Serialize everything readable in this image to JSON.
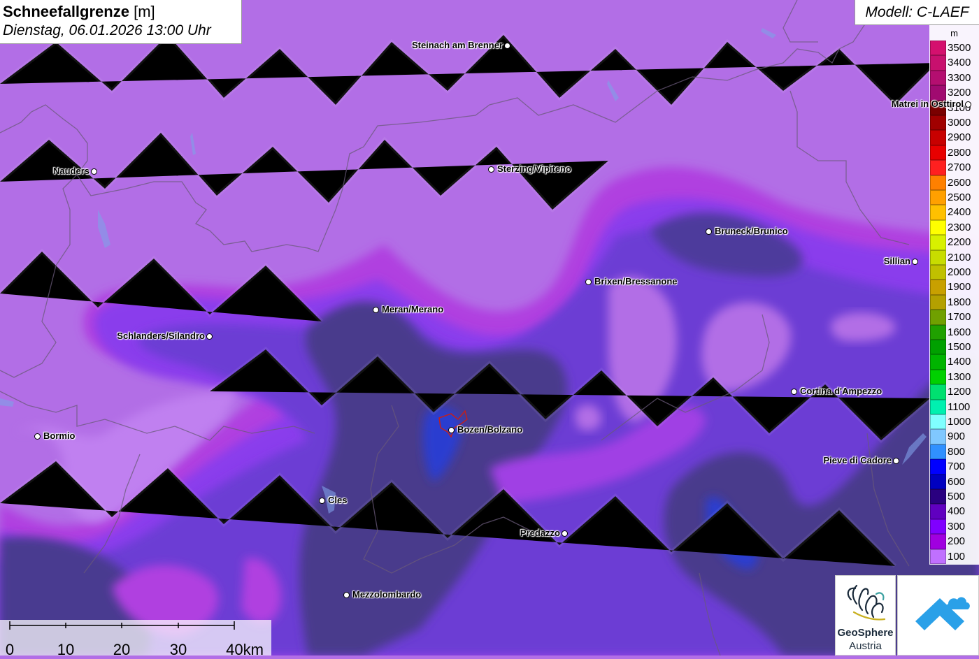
{
  "header": {
    "title": "Schneefallgrenze",
    "unit": "[m]",
    "datetime": "Dienstag, 06.01.2026 13:00 Uhr",
    "model": "Modell: C-LAEF"
  },
  "legend": {
    "unit": "m",
    "classes": [
      {
        "value": "3500",
        "color": "#d4106e"
      },
      {
        "value": "3400",
        "color": "#c8106e"
      },
      {
        "value": "3300",
        "color": "#b40e70"
      },
      {
        "value": "3200",
        "color": "#a00a70"
      },
      {
        "value": "3100",
        "color": "#7a0000"
      },
      {
        "value": "3000",
        "color": "#a00000"
      },
      {
        "value": "2900",
        "color": "#c80000"
      },
      {
        "value": "2800",
        "color": "#e80000"
      },
      {
        "value": "2700",
        "color": "#ff2020"
      },
      {
        "value": "2600",
        "color": "#ff8000"
      },
      {
        "value": "2500",
        "color": "#ffa000"
      },
      {
        "value": "2400",
        "color": "#ffc000"
      },
      {
        "value": "2300",
        "color": "#ffff00"
      },
      {
        "value": "2200",
        "color": "#d8f000"
      },
      {
        "value": "2100",
        "color": "#c8dc00"
      },
      {
        "value": "2000",
        "color": "#c0c000"
      },
      {
        "value": "1900",
        "color": "#c8a000"
      },
      {
        "value": "1800",
        "color": "#b4a000"
      },
      {
        "value": "1700",
        "color": "#70a000"
      },
      {
        "value": "1600",
        "color": "#20a000"
      },
      {
        "value": "1500",
        "color": "#00a000"
      },
      {
        "value": "1400",
        "color": "#00b400"
      },
      {
        "value": "1300",
        "color": "#00d000"
      },
      {
        "value": "1200",
        "color": "#00e070"
      },
      {
        "value": "1100",
        "color": "#00f0b0"
      },
      {
        "value": "1000",
        "color": "#80ffff"
      },
      {
        "value": "900",
        "color": "#80c8ff"
      },
      {
        "value": "800",
        "color": "#3090ff"
      },
      {
        "value": "700",
        "color": "#0000ff"
      },
      {
        "value": "600",
        "color": "#0000c0"
      },
      {
        "value": "500",
        "color": "#2a0080"
      },
      {
        "value": "400",
        "color": "#6000c0"
      },
      {
        "value": "300",
        "color": "#8000ff"
      },
      {
        "value": "200",
        "color": "#a000e0"
      },
      {
        "value": "100",
        "color": "#c070ff"
      }
    ]
  },
  "places": [
    {
      "name": "Steinach am Brenner",
      "label_side": "left"
    },
    {
      "name": "Nauders",
      "label_side": "left"
    },
    {
      "name": "Sterzing/Vipiteno",
      "label_side": "right"
    },
    {
      "name": "Matrei in Osttirol",
      "label_side": "left"
    },
    {
      "name": "Bruneck/Brunico",
      "label_side": "right"
    },
    {
      "name": "Sillian",
      "label_side": "left"
    },
    {
      "name": "Brixen/Bressanone",
      "label_side": "right"
    },
    {
      "name": "Meran/Merano",
      "label_side": "right"
    },
    {
      "name": "Schlanders/Silandro",
      "label_side": "left"
    },
    {
      "name": "Bozen/Bolzano",
      "label_side": "right"
    },
    {
      "name": "Cortina d'Ampezzo",
      "label_side": "right"
    },
    {
      "name": "Bormio",
      "label_side": "right"
    },
    {
      "name": "Pieve di Cadore",
      "label_side": "left"
    },
    {
      "name": "Cles",
      "label_side": "right"
    },
    {
      "name": "Predazzo",
      "label_side": "left"
    },
    {
      "name": "Mezzolombardo",
      "label_side": "right"
    }
  ],
  "scalebar": {
    "labels": [
      "0",
      "10",
      "20",
      "30",
      "40km"
    ]
  },
  "logos": {
    "geosphere_line1": "GeoSphere",
    "geosphere_line2": "Austria",
    "geosphere_icon": "geosphere-logo-icon",
    "second_icon": "blue-arrow-cloud-logo-icon"
  },
  "colors": {
    "base_light": "#b26ee6",
    "band_magenta": "#b43ce6",
    "band_purple": "#8c3cf0",
    "band_violet": "#6a3ccc",
    "band_dark": "#4a3a8c",
    "band_blue": "#2c3cd0"
  }
}
